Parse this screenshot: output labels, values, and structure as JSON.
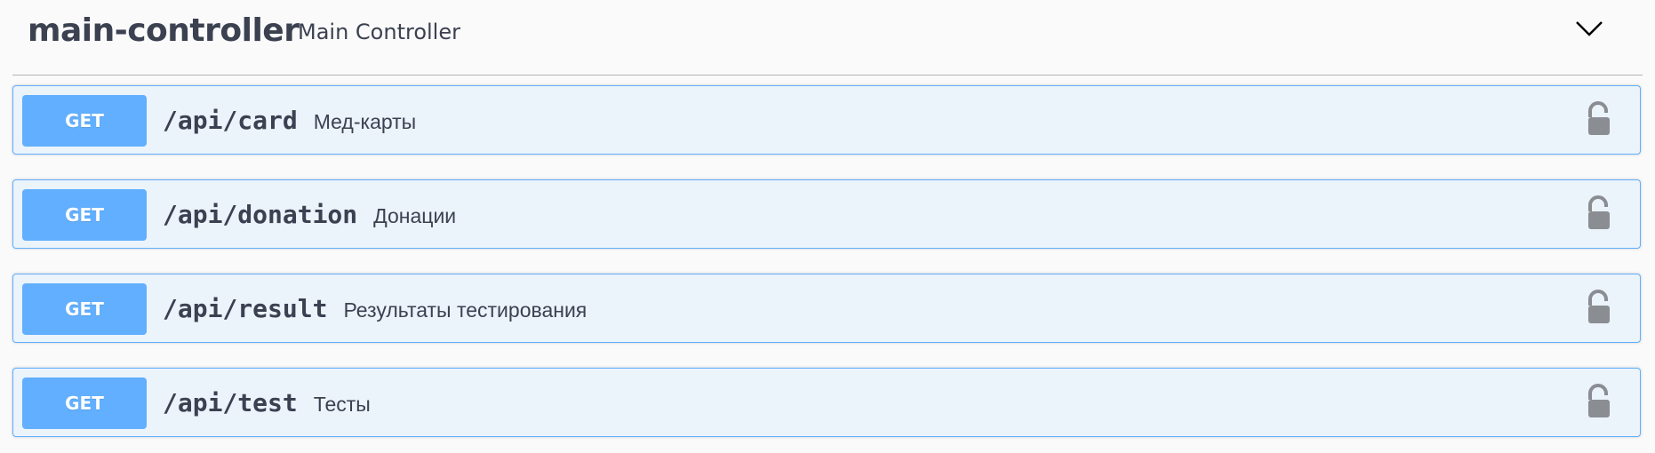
{
  "tag": {
    "name": "main-controller",
    "description": "Main Controller",
    "chevron_icon": "chevron-down-icon"
  },
  "operations": [
    {
      "method": "GET",
      "path": "/api/card",
      "summary": "Мед-карты",
      "lock_icon": "unlocked-icon"
    },
    {
      "method": "GET",
      "path": "/api/donation",
      "summary": "Донации",
      "lock_icon": "unlocked-icon"
    },
    {
      "method": "GET",
      "path": "/api/result",
      "summary": "Результаты тестирования",
      "lock_icon": "unlocked-icon"
    },
    {
      "method": "GET",
      "path": "/api/test",
      "summary": "Тесты",
      "lock_icon": "unlocked-icon"
    }
  ],
  "colors": {
    "get_accent": "#61affe",
    "get_background": "#ebf3fb",
    "text": "#3b4151",
    "lock": "#8a8d92"
  }
}
